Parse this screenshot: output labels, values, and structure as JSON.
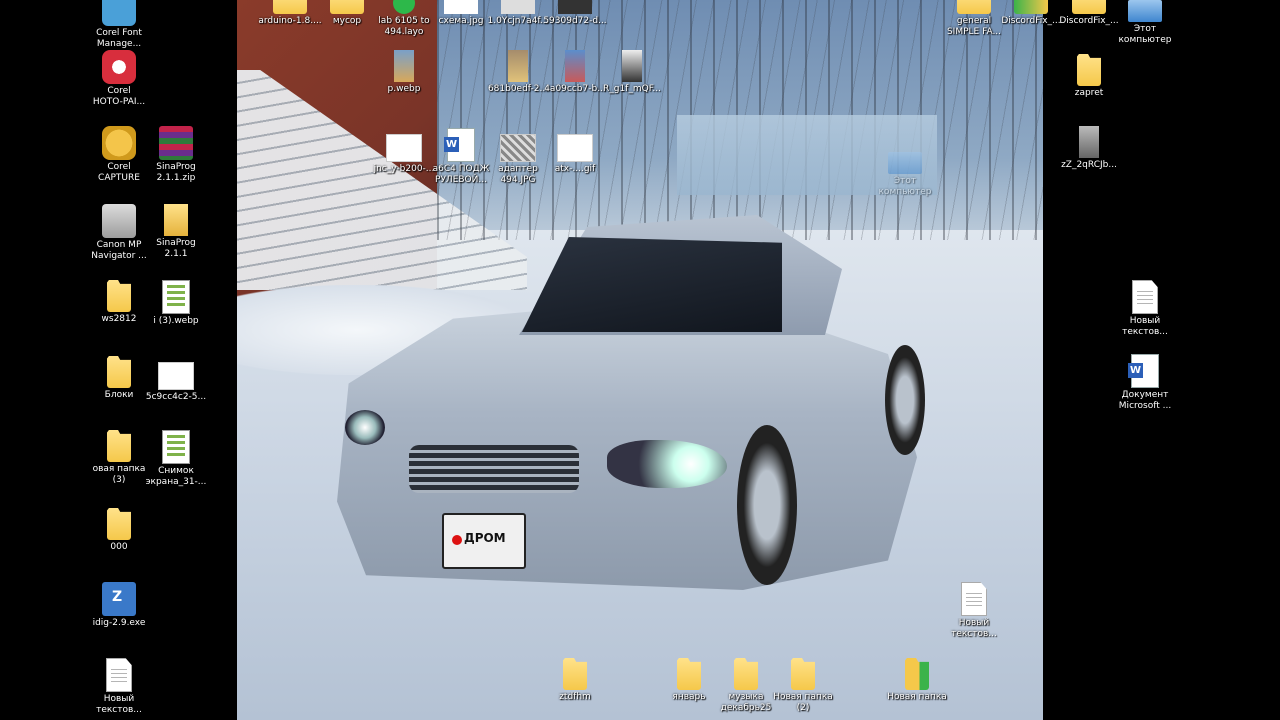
{
  "desktop": {
    "left_column": [
      {
        "label": "Corel Font\nManage...",
        "icon": "corel-font-icon"
      },
      {
        "label": "Corel\nHOTO-PAI...",
        "icon": "corel-photopaint-icon"
      },
      {
        "label": "Corel\nCAPTURE",
        "icon": "corel-capture-icon"
      },
      {
        "label": "SinaProg\n2.1.1.zip",
        "icon": "winrar-archive-icon"
      },
      {
        "label": "Canon MP\nNavigator ...",
        "icon": "canon-printer-icon"
      },
      {
        "label": "SinaProg\n2.1.1",
        "icon": "folder-icon"
      },
      {
        "label": "ws2812",
        "icon": "folder-icon"
      },
      {
        "label": "i (3).webp",
        "icon": "image-file-icon"
      },
      {
        "label": "Блоки",
        "icon": "folder-icon"
      },
      {
        "label": "5c9cc4c2-5...",
        "icon": "image-file-icon"
      },
      {
        "label": "овая папка\n(3)",
        "icon": "folder-icon"
      },
      {
        "label": "Снимок\nэкрана_31-...",
        "icon": "image-file-icon"
      },
      {
        "label": "000",
        "icon": "folder-icon"
      },
      {
        "label": "idig-2.9.exe",
        "icon": "zadig-exe-icon"
      },
      {
        "label": "Новый\nтекстов...",
        "icon": "text-document-icon"
      }
    ],
    "top_row": [
      {
        "label": "arduino-1.8....",
        "icon": "folder-icon"
      },
      {
        "label": "мусор",
        "icon": "folder-icon"
      },
      {
        "label": "lab 6105 to\n494.layo",
        "icon": "layout-file-icon"
      },
      {
        "label": "схема.jpg",
        "icon": "image-file-icon"
      },
      {
        "label": "1.0Ycjn7a4f...",
        "icon": "image-file-icon"
      },
      {
        "label": "59309d72-d...",
        "icon": "image-file-icon"
      }
    ],
    "second_row": [
      {
        "label": "p.webp",
        "icon": "photo-thumb-icon"
      },
      {
        "label": "681b0edf-2...",
        "icon": "photo-thumb-icon"
      },
      {
        "label": "4a09ccb7-b...",
        "icon": "photo-thumb-icon"
      },
      {
        "label": "R_g1f_mQF...",
        "icon": "photo-thumb-icon"
      }
    ],
    "third_row": [
      {
        "label": "jnc_y-b200-...",
        "icon": "image-file-icon"
      },
      {
        "label": "a6C4 ПОДЖ\nРУЛЕВОЙ...",
        "icon": "word-document-icon"
      },
      {
        "label": "адаптер\n494.JPG",
        "icon": "image-file-icon"
      },
      {
        "label": "atx-....gif",
        "icon": "image-file-icon"
      }
    ],
    "top_right": [
      {
        "label": "general\nSIMPLE FA...",
        "icon": "folder-icon"
      },
      {
        "label": "DiscordFix_...",
        "icon": "folder-icon"
      },
      {
        "label": "DiscordFix_...",
        "icon": "folder-icon"
      },
      {
        "label": "Этот\nкомпьютер",
        "icon": "computer-icon"
      }
    ],
    "right_column": [
      {
        "label": "zapret",
        "icon": "folder-icon"
      },
      {
        "label": "zZ_2qRCJb...",
        "icon": "photo-thumb-icon"
      },
      {
        "label": "Новый\nтекстов...",
        "icon": "text-document-icon"
      },
      {
        "label": "Документ\nMicrosoft ...",
        "icon": "word-document-icon"
      }
    ],
    "ghost_icon": {
      "label": "Этот\nкомпьютер"
    },
    "wallpaper_plate": "ДРОМ",
    "bottom_row": [
      {
        "label": "ztdfhm",
        "icon": "folder-icon"
      },
      {
        "label": "январь",
        "icon": "folder-icon"
      },
      {
        "label": "музыка\nдекабрь25",
        "icon": "folder-icon"
      },
      {
        "label": "Новая папка\n(2)",
        "icon": "folder-icon"
      },
      {
        "label": "Новая папка",
        "icon": "folder-icon"
      },
      {
        "label": "Новый\nтекстов...",
        "icon": "text-document-icon"
      }
    ]
  }
}
